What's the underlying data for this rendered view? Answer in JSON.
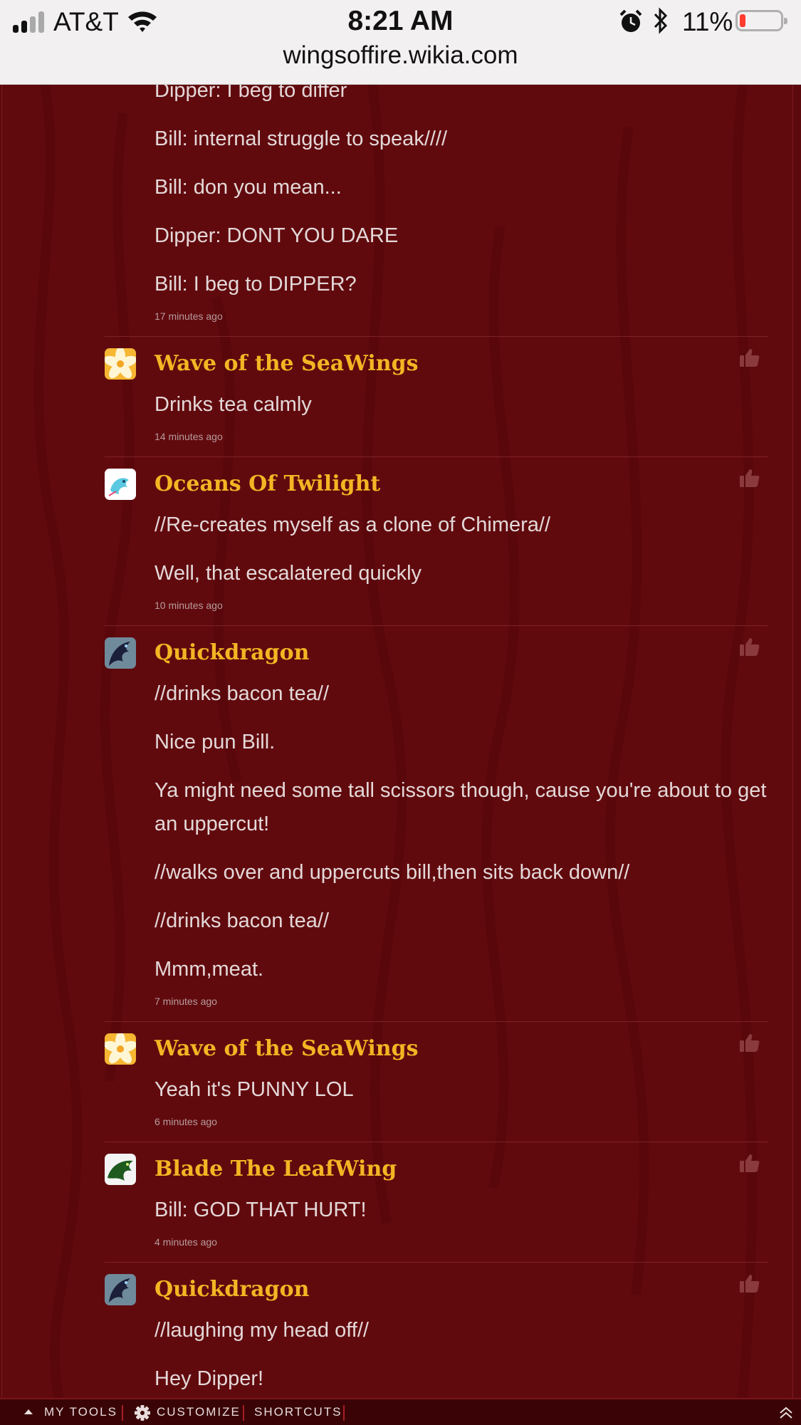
{
  "status_bar": {
    "carrier": "AT&T",
    "time": "8:21 AM",
    "battery_percent": "11%"
  },
  "url": "wingsoffire.wikia.com",
  "partial_comment": {
    "lines": [
      "Dipper: I beg to differ",
      "Bill: internal struggle to speak////",
      "Bill: don you mean...",
      "Dipper: DONT YOU DARE",
      "Bill: I beg to DIPPER?"
    ],
    "time": "17 minutes ago"
  },
  "comments": [
    {
      "author": "Wave of the SeaWings",
      "avatar": "plumeria-flower",
      "lines": [
        "Drinks tea calmly"
      ],
      "time": "14 minutes ago"
    },
    {
      "author": "Oceans Of Twilight",
      "avatar": "cyan-dragon-drawing",
      "lines": [
        "//Re-creates myself as a clone of Chimera//",
        "Well, that escalatered quickly"
      ],
      "time": "10 minutes ago"
    },
    {
      "author": "Quickdragon",
      "avatar": "dark-dragon",
      "lines": [
        "//drinks bacon tea//",
        "Nice pun Bill.",
        "Ya might need some tall scissors though, cause you're about to get an uppercut!",
        "//walks over and uppercuts bill,then sits back down//",
        "//drinks bacon tea//",
        "Mmm,meat."
      ],
      "time": "7 minutes ago"
    },
    {
      "author": "Wave of the SeaWings",
      "avatar": "plumeria-flower",
      "lines": [
        "Yeah it's PUNNY LOL"
      ],
      "time": "6 minutes ago"
    },
    {
      "author": "Blade The LeafWing",
      "avatar": "green-dragon",
      "lines": [
        "Bill: GOD THAT HURT!"
      ],
      "time": "4 minutes ago"
    },
    {
      "author": "Quickdragon",
      "avatar": "dark-dragon",
      "lines": [
        "//laughing my head off//",
        "Hey Dipper!"
      ],
      "time": ""
    }
  ],
  "toolbar": {
    "my_tools": "MY TOOLS",
    "customize": "CUSTOMIZE",
    "shortcuts": "SHORTCUTS"
  },
  "colors": {
    "background": "#610a0e",
    "author": "#f4b524",
    "text": "#e4d8d8"
  }
}
